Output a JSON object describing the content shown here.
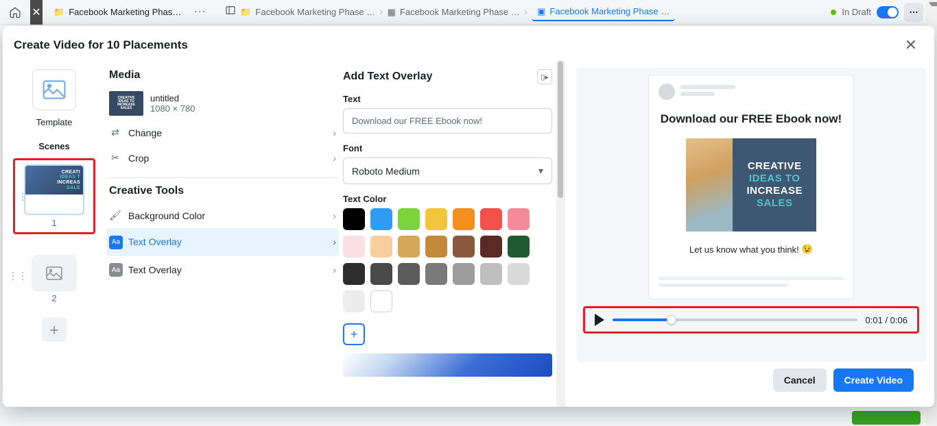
{
  "nav": {
    "page_tab": "Facebook Marketing Phas…",
    "crumb1": "Facebook Marketing Phase …",
    "crumb2": "Facebook Marketing Phase …",
    "crumb3": "Facebook Marketing Phase …",
    "status": "In Draft"
  },
  "modal": {
    "title": "Create Video for 10 Placements",
    "template_label": "Template",
    "scenes_label": "Scenes",
    "scene1_num": "1",
    "scene2_num": "2"
  },
  "media": {
    "section": "Media",
    "name": "untitled",
    "dimensions": "1080 × 780",
    "change": "Change",
    "crop": "Crop"
  },
  "tools": {
    "section": "Creative Tools",
    "bg_color": "Background Color",
    "text_overlay_active": "Text Overlay",
    "text_overlay2": "Text Overlay"
  },
  "overlay": {
    "title": "Add Text Overlay",
    "text_label": "Text",
    "text_value": "Download our FREE Ebook now!",
    "font_label": "Font",
    "font_value": "Roboto Medium",
    "color_label": "Text Color",
    "colors_row1": [
      "#000000",
      "#2f9bf2",
      "#7dd33b",
      "#f2c53d",
      "#f38f1f",
      "#f2524b",
      "#f48b98",
      "#fcdfe3"
    ],
    "colors_row2": [
      "#f7cf9e",
      "#d6a756",
      "#c48a3a",
      "#885a3f",
      "#5a2a24",
      "#1f5a32",
      "#2d2d2d",
      "#4a4a4a"
    ],
    "colors_row3": [
      "#5c5c5c",
      "#7a7a7a",
      "#9c9c9c",
      "#bfbfbf",
      "#d9d9d9",
      "#ececec",
      "#ffffff"
    ]
  },
  "preview": {
    "headline": "Download our FREE Ebook now!",
    "img_l1": "CREATIVE",
    "img_l2": "IDEAS TO",
    "img_l3": "INCREASE",
    "img_l4": "SALES",
    "caption": "Let us know what you think!",
    "emoji": "😉",
    "time": "0:01 / 0:06"
  },
  "footer": {
    "cancel": "Cancel",
    "create": "Create Video"
  },
  "thumb": {
    "l1": "CREATI",
    "l2": "IDEAS T",
    "l3": "INCREAS",
    "l4": "SALE"
  }
}
